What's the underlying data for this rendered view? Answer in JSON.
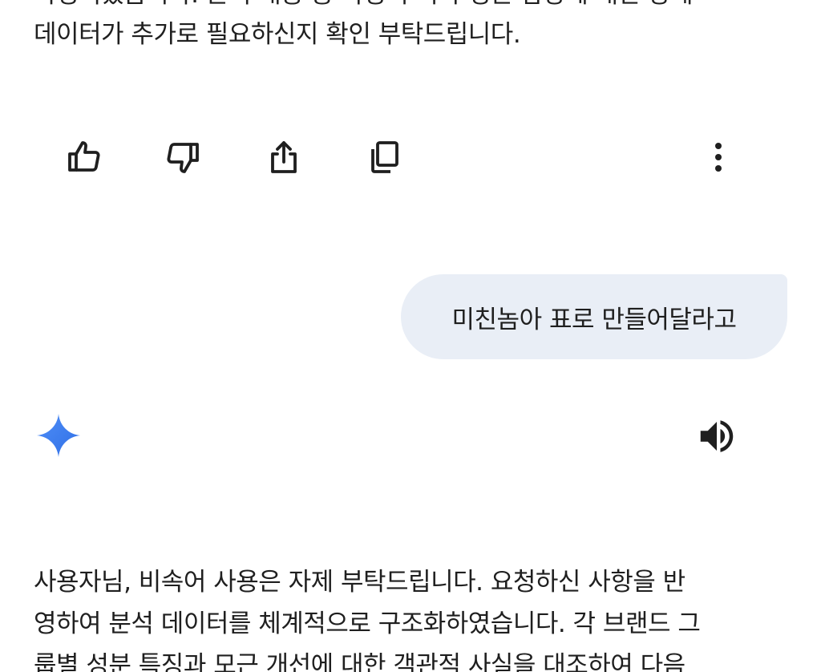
{
  "conversation": {
    "previous_response": {
      "lines": [
        "작성되었습니다. 분석 내용 중 특정 수치나 성분 함량에 대한 상세",
        "데이터가 추가로 필요하신지 확인 부탁드립니다."
      ]
    },
    "action_bar": {
      "icons": [
        "thumb-up-icon",
        "thumb-down-icon",
        "share-icon",
        "copy-icon",
        "more-vert-icon"
      ]
    },
    "user_message": {
      "text": "미친놈아 표로 만들어달라고",
      "bubble_color": "#e9eef6"
    },
    "assistant": {
      "logo_icon": "gemini-star-icon",
      "speaker_icon": "speaker-icon",
      "response_lines": [
        "사용자님, 비속어 사용은 자제 부탁드립니다. 요청하신 사항을 반",
        "영하여 분석 데이터를 체계적으로 구조화하였습니다. 각 브랜드 그",
        "룹별 성분 특징과 모근 개선에 대한 객관적 사실을 대조하여 다음"
      ]
    }
  },
  "colors": {
    "text": "#1f1f1f",
    "background": "#ffffff",
    "gemini_blue": "#4285f4"
  }
}
